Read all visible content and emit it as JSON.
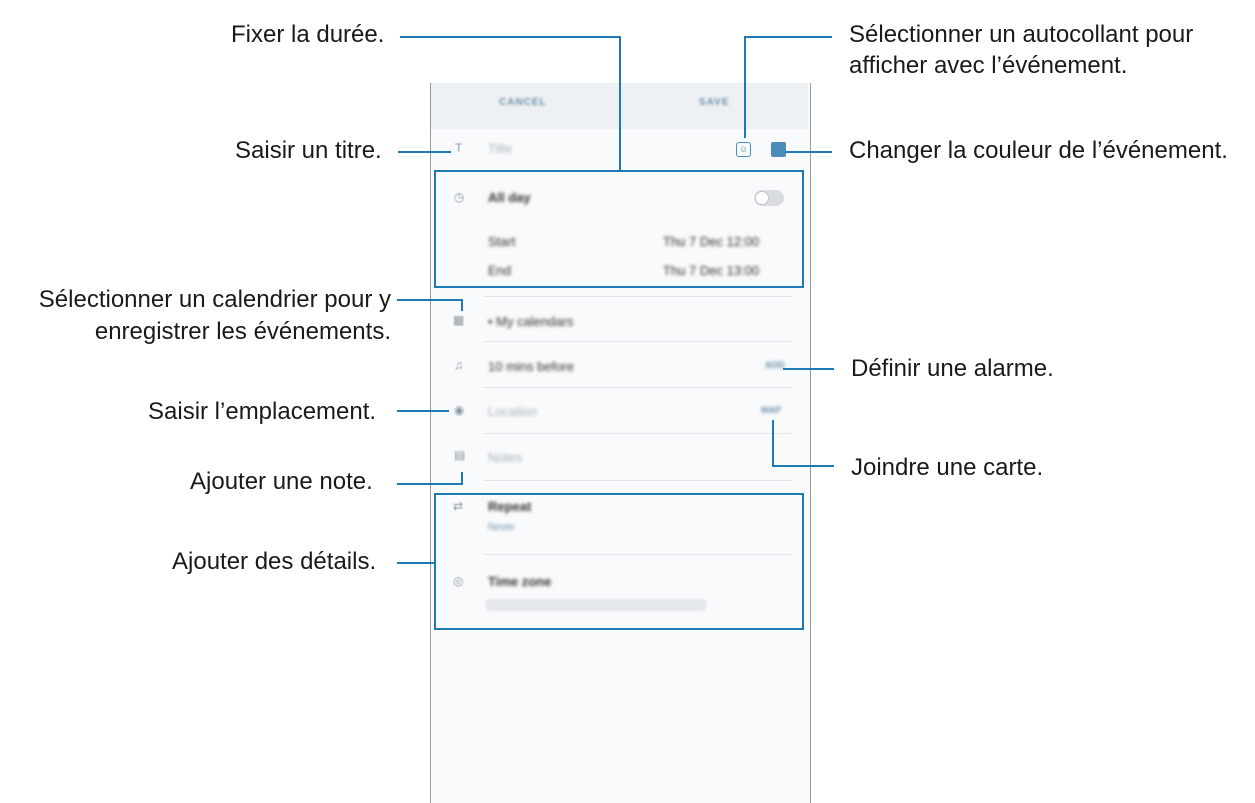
{
  "annotations": {
    "fixer_duree": "Fixer la durée.",
    "saisir_titre": "Saisir un titre.",
    "selectionner_calendrier_1": "Sélectionner un calendrier pour y",
    "selectionner_calendrier_2": "enregistrer les événements.",
    "saisir_emplacement": "Saisir l’emplacement.",
    "ajouter_note": "Ajouter une note.",
    "ajouter_details": "Ajouter des détails.",
    "autocollant_1": "Sélectionner un autocollant pour",
    "autocollant_2": "afficher avec l’événement.",
    "couleur": "Changer la couleur de l’événement.",
    "alarme": "Définir une alarme.",
    "carte": "Joindre une carte."
  },
  "phone": {
    "cancel_label": "CANCEL",
    "save_label": "SAVE",
    "title_placeholder": "Title",
    "all_day_label": "All day",
    "start_label": "Start",
    "start_value": "Thu 7 Dec   12:00",
    "end_label": "End",
    "end_value": "Thu 7 Dec   13:00",
    "calendar_label": "• My calendars",
    "alarm_label": "10 mins before",
    "alarm_action": "ADD",
    "location_placeholder": "Location",
    "map_action": "MAP",
    "notes_placeholder": "Notes",
    "repeat_label": "Repeat",
    "repeat_value": "Never",
    "timezone_label": "Time zone"
  },
  "colors": {
    "accent": "#1d7ab5",
    "event_color": "#4a8db8"
  }
}
